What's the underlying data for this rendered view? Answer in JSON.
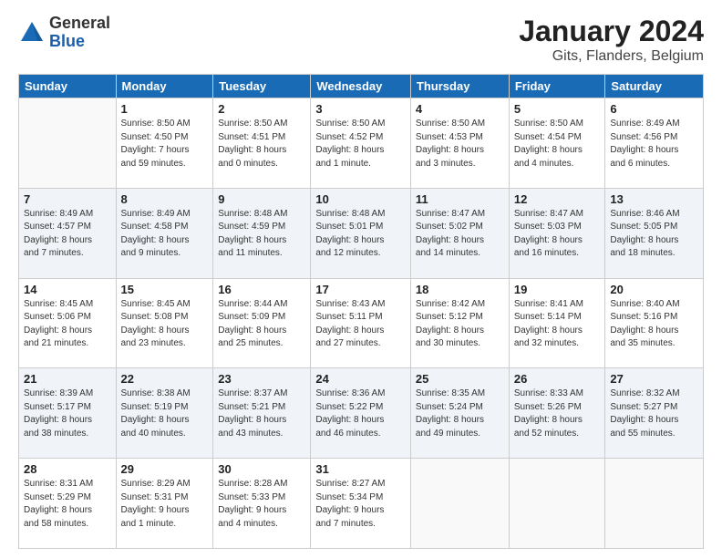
{
  "header": {
    "logo_general": "General",
    "logo_blue": "Blue",
    "title": "January 2024",
    "subtitle": "Gits, Flanders, Belgium"
  },
  "weekdays": [
    "Sunday",
    "Monday",
    "Tuesday",
    "Wednesday",
    "Thursday",
    "Friday",
    "Saturday"
  ],
  "weeks": [
    [
      {
        "day": "",
        "info": ""
      },
      {
        "day": "1",
        "info": "Sunrise: 8:50 AM\nSunset: 4:50 PM\nDaylight: 7 hours\nand 59 minutes."
      },
      {
        "day": "2",
        "info": "Sunrise: 8:50 AM\nSunset: 4:51 PM\nDaylight: 8 hours\nand 0 minutes."
      },
      {
        "day": "3",
        "info": "Sunrise: 8:50 AM\nSunset: 4:52 PM\nDaylight: 8 hours\nand 1 minute."
      },
      {
        "day": "4",
        "info": "Sunrise: 8:50 AM\nSunset: 4:53 PM\nDaylight: 8 hours\nand 3 minutes."
      },
      {
        "day": "5",
        "info": "Sunrise: 8:50 AM\nSunset: 4:54 PM\nDaylight: 8 hours\nand 4 minutes."
      },
      {
        "day": "6",
        "info": "Sunrise: 8:49 AM\nSunset: 4:56 PM\nDaylight: 8 hours\nand 6 minutes."
      }
    ],
    [
      {
        "day": "7",
        "info": "Sunrise: 8:49 AM\nSunset: 4:57 PM\nDaylight: 8 hours\nand 7 minutes."
      },
      {
        "day": "8",
        "info": "Sunrise: 8:49 AM\nSunset: 4:58 PM\nDaylight: 8 hours\nand 9 minutes."
      },
      {
        "day": "9",
        "info": "Sunrise: 8:48 AM\nSunset: 4:59 PM\nDaylight: 8 hours\nand 11 minutes."
      },
      {
        "day": "10",
        "info": "Sunrise: 8:48 AM\nSunset: 5:01 PM\nDaylight: 8 hours\nand 12 minutes."
      },
      {
        "day": "11",
        "info": "Sunrise: 8:47 AM\nSunset: 5:02 PM\nDaylight: 8 hours\nand 14 minutes."
      },
      {
        "day": "12",
        "info": "Sunrise: 8:47 AM\nSunset: 5:03 PM\nDaylight: 8 hours\nand 16 minutes."
      },
      {
        "day": "13",
        "info": "Sunrise: 8:46 AM\nSunset: 5:05 PM\nDaylight: 8 hours\nand 18 minutes."
      }
    ],
    [
      {
        "day": "14",
        "info": "Sunrise: 8:45 AM\nSunset: 5:06 PM\nDaylight: 8 hours\nand 21 minutes."
      },
      {
        "day": "15",
        "info": "Sunrise: 8:45 AM\nSunset: 5:08 PM\nDaylight: 8 hours\nand 23 minutes."
      },
      {
        "day": "16",
        "info": "Sunrise: 8:44 AM\nSunset: 5:09 PM\nDaylight: 8 hours\nand 25 minutes."
      },
      {
        "day": "17",
        "info": "Sunrise: 8:43 AM\nSunset: 5:11 PM\nDaylight: 8 hours\nand 27 minutes."
      },
      {
        "day": "18",
        "info": "Sunrise: 8:42 AM\nSunset: 5:12 PM\nDaylight: 8 hours\nand 30 minutes."
      },
      {
        "day": "19",
        "info": "Sunrise: 8:41 AM\nSunset: 5:14 PM\nDaylight: 8 hours\nand 32 minutes."
      },
      {
        "day": "20",
        "info": "Sunrise: 8:40 AM\nSunset: 5:16 PM\nDaylight: 8 hours\nand 35 minutes."
      }
    ],
    [
      {
        "day": "21",
        "info": "Sunrise: 8:39 AM\nSunset: 5:17 PM\nDaylight: 8 hours\nand 38 minutes."
      },
      {
        "day": "22",
        "info": "Sunrise: 8:38 AM\nSunset: 5:19 PM\nDaylight: 8 hours\nand 40 minutes."
      },
      {
        "day": "23",
        "info": "Sunrise: 8:37 AM\nSunset: 5:21 PM\nDaylight: 8 hours\nand 43 minutes."
      },
      {
        "day": "24",
        "info": "Sunrise: 8:36 AM\nSunset: 5:22 PM\nDaylight: 8 hours\nand 46 minutes."
      },
      {
        "day": "25",
        "info": "Sunrise: 8:35 AM\nSunset: 5:24 PM\nDaylight: 8 hours\nand 49 minutes."
      },
      {
        "day": "26",
        "info": "Sunrise: 8:33 AM\nSunset: 5:26 PM\nDaylight: 8 hours\nand 52 minutes."
      },
      {
        "day": "27",
        "info": "Sunrise: 8:32 AM\nSunset: 5:27 PM\nDaylight: 8 hours\nand 55 minutes."
      }
    ],
    [
      {
        "day": "28",
        "info": "Sunrise: 8:31 AM\nSunset: 5:29 PM\nDaylight: 8 hours\nand 58 minutes."
      },
      {
        "day": "29",
        "info": "Sunrise: 8:29 AM\nSunset: 5:31 PM\nDaylight: 9 hours\nand 1 minute."
      },
      {
        "day": "30",
        "info": "Sunrise: 8:28 AM\nSunset: 5:33 PM\nDaylight: 9 hours\nand 4 minutes."
      },
      {
        "day": "31",
        "info": "Sunrise: 8:27 AM\nSunset: 5:34 PM\nDaylight: 9 hours\nand 7 minutes."
      },
      {
        "day": "",
        "info": ""
      },
      {
        "day": "",
        "info": ""
      },
      {
        "day": "",
        "info": ""
      }
    ]
  ]
}
